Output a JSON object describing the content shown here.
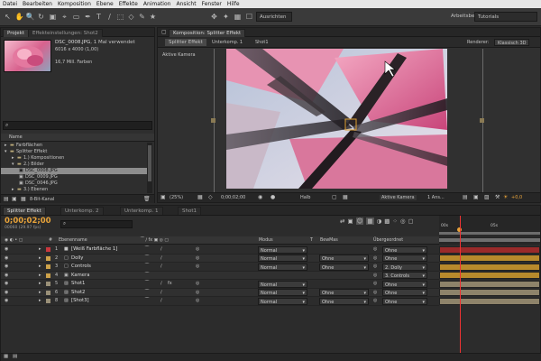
{
  "menu": [
    "Datei",
    "Bearbeiten",
    "Komposition",
    "Ebene",
    "Effekte",
    "Animation",
    "Ansicht",
    "Fenster",
    "Hilfe"
  ],
  "toolbar": {
    "align_label": "Ausrichten",
    "workspace_label": "Arbeitsbereich:",
    "workspace_value": "Tutorials"
  },
  "project_panel": {
    "tab_project": "Projekt",
    "tab_effects": "Effekteinstellungen: Shot2",
    "file_name": "DSC_0008.JPG",
    "file_used": ", 1 Mal verwendet",
    "file_dims": "6016 x 4000 (1,00)",
    "file_colors": "16,7 Mill. Farben",
    "search_placeholder": "",
    "column_name": "Name",
    "tree": [
      {
        "label": "Farbflächen",
        "indent": 1
      },
      {
        "label": "Splitter Effekt",
        "indent": 1
      },
      {
        "label": "1.) Kompositionen",
        "indent": 2
      },
      {
        "label": "2.) Bilder",
        "indent": 2
      },
      {
        "label": "DSC_0008.JPG",
        "indent": 3
      },
      {
        "label": "DSC_0009.JPG",
        "indent": 3
      },
      {
        "label": "DSC_0046.JPG",
        "indent": 3
      },
      {
        "label": "3.) Ebenen",
        "indent": 2
      }
    ],
    "bit_depth": "8-Bit-Kanal"
  },
  "comp_panel": {
    "tab_label": "Komposition: Splitter Effekt",
    "breadcrumbs": [
      "Splitter Effekt",
      "Unterkomp. 1",
      "Shot1"
    ],
    "renderer_label": "Renderer:",
    "renderer_value": "Klassisch 3D",
    "active_camera": "Aktive Kamera",
    "zoom": "(25%)",
    "timecode": "0;00;02;00",
    "resolution": "Halb",
    "view": "Aktive Kamera",
    "views": "1 Ans...",
    "exposure": "+0,0"
  },
  "timeline": {
    "tabs": [
      "Splitter Effekt",
      "Unterkomp. 2",
      "Unterkomp. 1",
      "Shot1"
    ],
    "timecode": "0;00;02;00",
    "fps": "00060 (29.97 fps)",
    "search_placeholder": "",
    "headers": {
      "name": "Ebenenname",
      "mode": "Modus",
      "t": "T",
      "trkmat": "BewMas",
      "parent": "Übergeordnet"
    },
    "ruler": [
      "00s",
      "05s"
    ],
    "layers": [
      {
        "num": "1",
        "name": "[Weiß Farbfläche 1]",
        "color": "#c8383e",
        "mode": "Normal",
        "trk": "",
        "parent": "Ohne",
        "bar": "#9a2a2a"
      },
      {
        "num": "2",
        "name": "Dolly",
        "color": "#cda24a",
        "mode": "Normal",
        "trk": "Ohne",
        "parent": "Ohne",
        "bar": "#b88a2c"
      },
      {
        "num": "3",
        "name": "Controls",
        "color": "#cda24a",
        "mode": "Normal",
        "trk": "Ohne",
        "parent": "2. Dolly",
        "bar": "#b88a2c"
      },
      {
        "num": "4",
        "name": "Kamera",
        "color": "#cda24a",
        "mode": "",
        "trk": "",
        "parent": "3. Controls",
        "bar": "#b88a2c"
      },
      {
        "num": "5",
        "name": "Shot1",
        "color": "#9a9078",
        "mode": "Normal",
        "trk": "",
        "parent": "Ohne",
        "bar": "#8e836a"
      },
      {
        "num": "6",
        "name": "Shot2",
        "color": "#9a9078",
        "mode": "Normal",
        "trk": "Ohne",
        "parent": "Ohne",
        "bar": "#8e836a"
      },
      {
        "num": "8",
        "name": "[Shot3]",
        "color": "#9a9078",
        "mode": "Normal",
        "trk": "Ohne",
        "parent": "Ohne",
        "bar": "#8e836a"
      }
    ]
  },
  "colors": {
    "accent": "#e8a33a",
    "timecode": "#e8a33a",
    "selection": "#8d8d8d"
  }
}
